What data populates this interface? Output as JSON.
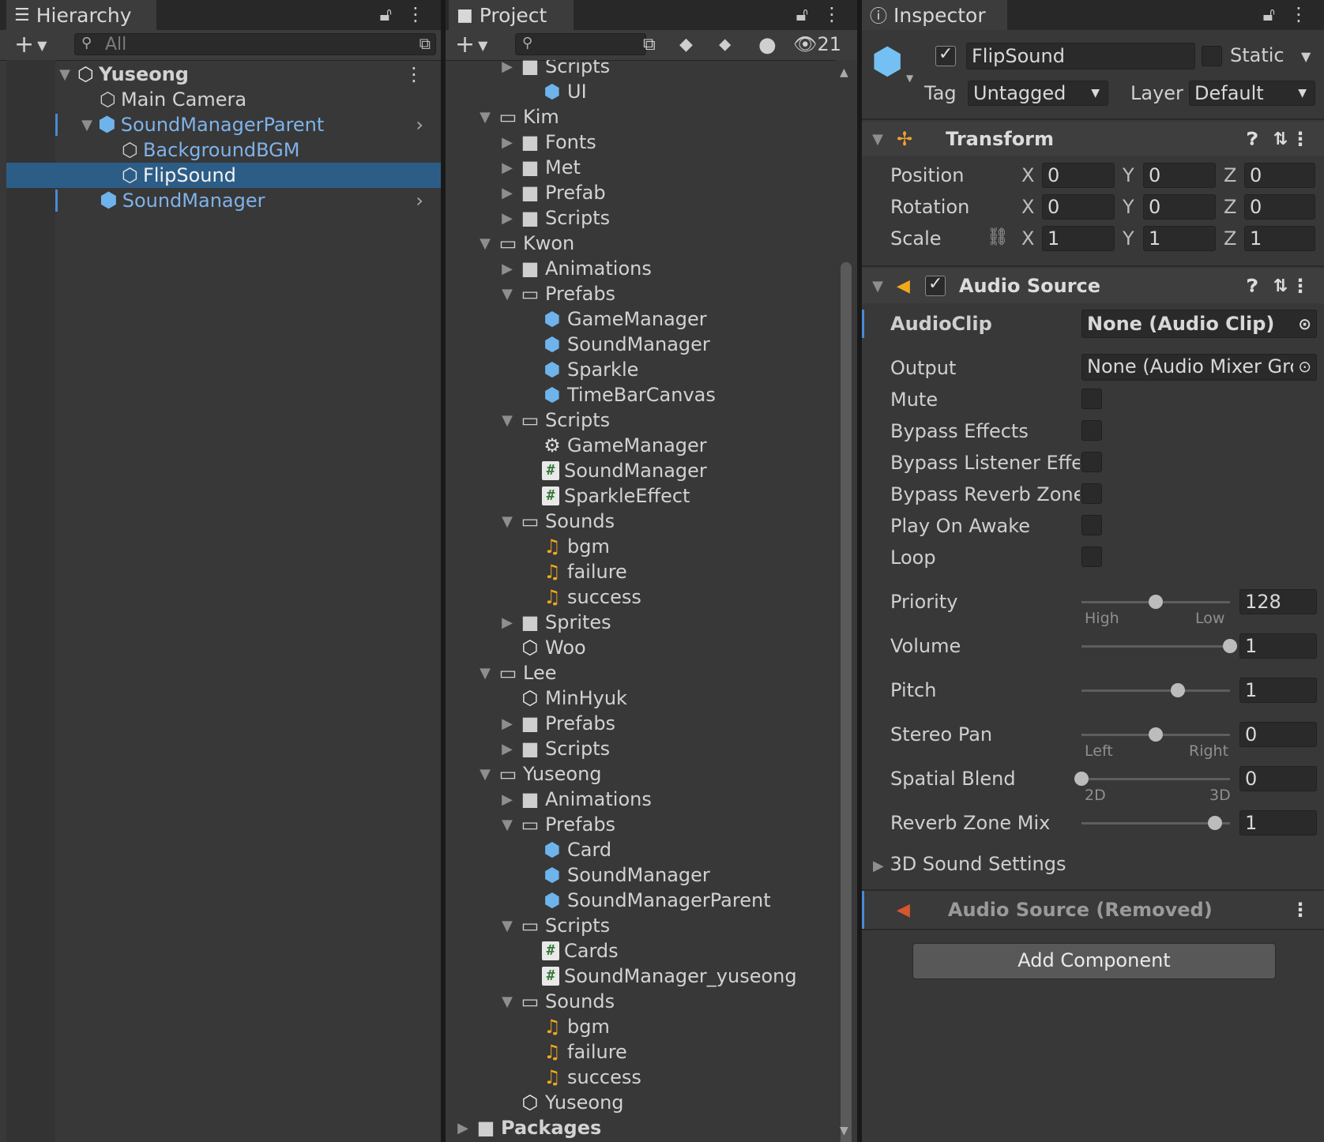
{
  "colors": {
    "selection": "#2c5d87",
    "prefab_blue": "#7fb2ea",
    "audio_orange": "#f2a81d"
  },
  "hierarchy": {
    "tab_label": "Hierarchy",
    "search_placeholder": "All",
    "items": [
      {
        "label": "Yuseong"
      },
      {
        "label": "Main Camera"
      },
      {
        "label": "SoundManagerParent"
      },
      {
        "label": "BackgroundBGM"
      },
      {
        "label": "FlipSound"
      },
      {
        "label": "SoundManager"
      }
    ]
  },
  "project": {
    "tab_label": "Project",
    "hidden_count": "21",
    "items": [
      {
        "label": "Scripts",
        "icon": "folder-icon"
      },
      {
        "label": "UI",
        "icon": "prefab-icon"
      },
      {
        "label": "Kim",
        "icon": "folder-open-icon"
      },
      {
        "label": "Fonts",
        "icon": "folder-icon"
      },
      {
        "label": "Met",
        "icon": "folder-icon"
      },
      {
        "label": "Prefab",
        "icon": "folder-icon"
      },
      {
        "label": "Scripts",
        "icon": "folder-icon"
      },
      {
        "label": "Kwon",
        "icon": "folder-open-icon"
      },
      {
        "label": "Animations",
        "icon": "folder-icon"
      },
      {
        "label": "Prefabs",
        "icon": "folder-open-icon"
      },
      {
        "label": "GameManager",
        "icon": "prefab-icon"
      },
      {
        "label": "SoundManager",
        "icon": "prefab-icon"
      },
      {
        "label": "Sparkle",
        "icon": "prefab-icon"
      },
      {
        "label": "TimeBarCanvas",
        "icon": "prefab-icon"
      },
      {
        "label": "Scripts",
        "icon": "folder-open-icon"
      },
      {
        "label": "GameManager",
        "icon": "gear-icon"
      },
      {
        "label": "SoundManager",
        "icon": "script-icon"
      },
      {
        "label": "SparkleEffect",
        "icon": "script-icon"
      },
      {
        "label": "Sounds",
        "icon": "folder-open-icon"
      },
      {
        "label": "bgm",
        "icon": "audio-clip-icon"
      },
      {
        "label": "failure",
        "icon": "audio-clip-icon"
      },
      {
        "label": "success",
        "icon": "audio-clip-icon"
      },
      {
        "label": "Sprites",
        "icon": "folder-icon"
      },
      {
        "label": "Woo",
        "icon": "unity-scene-icon"
      },
      {
        "label": "Lee",
        "icon": "folder-open-icon"
      },
      {
        "label": "MinHyuk",
        "icon": "unity-scene-icon"
      },
      {
        "label": "Prefabs",
        "icon": "folder-icon"
      },
      {
        "label": "Scripts",
        "icon": "folder-icon"
      },
      {
        "label": "Yuseong",
        "icon": "folder-open-icon"
      },
      {
        "label": "Animations",
        "icon": "folder-icon"
      },
      {
        "label": "Prefabs",
        "icon": "folder-open-icon"
      },
      {
        "label": "Card",
        "icon": "prefab-icon"
      },
      {
        "label": "SoundManager",
        "icon": "prefab-icon"
      },
      {
        "label": "SoundManagerParent",
        "icon": "prefab-icon"
      },
      {
        "label": "Scripts",
        "icon": "folder-open-icon"
      },
      {
        "label": "Cards",
        "icon": "script-icon"
      },
      {
        "label": "SoundManager_yuseong",
        "icon": "script-icon"
      },
      {
        "label": "Sounds",
        "icon": "folder-open-icon"
      },
      {
        "label": "bgm",
        "icon": "audio-clip-icon"
      },
      {
        "label": "failure",
        "icon": "audio-clip-icon"
      },
      {
        "label": "success",
        "icon": "audio-clip-icon"
      },
      {
        "label": "Yuseong",
        "icon": "unity-scene-icon"
      },
      {
        "label": "Packages",
        "icon": "folder-icon"
      }
    ]
  },
  "inspector": {
    "tab_label": "Inspector",
    "object_name": "FlipSound",
    "active": true,
    "static_label": "Static",
    "tag_label": "Tag",
    "tag_value": "Untagged",
    "layer_label": "Layer",
    "layer_value": "Default",
    "transform": {
      "title": "Transform",
      "position_label": "Position",
      "rotation_label": "Rotation",
      "scale_label": "Scale",
      "x": "X",
      "y": "Y",
      "z": "Z",
      "position": [
        "0",
        "0",
        "0"
      ],
      "rotation": [
        "0",
        "0",
        "0"
      ],
      "scale": [
        "1",
        "1",
        "1"
      ]
    },
    "audio_source": {
      "title": "Audio Source",
      "enabled": true,
      "audioclip_label": "AudioClip",
      "audioclip_value": "None (Audio Clip)",
      "output_label": "Output",
      "output_value": "None (Audio Mixer Group)",
      "mute_label": "Mute",
      "bypass_effects_label": "Bypass Effects",
      "bypass_listener_label": "Bypass Listener Effects",
      "bypass_reverb_label": "Bypass Reverb Zones",
      "play_on_awake_label": "Play On Awake",
      "loop_label": "Loop",
      "priority_label": "Priority",
      "priority_value": "128",
      "priority_level": 0.5,
      "priority_low_label": "High",
      "priority_high_label": "Low",
      "volume_label": "Volume",
      "volume_value": "1",
      "volume_level": 1.0,
      "pitch_label": "Pitch",
      "pitch_value": "1",
      "pitch_level": 0.65,
      "stereo_pan_label": "Stereo Pan",
      "stereo_pan_value": "0",
      "stereo_pan_level": 0.5,
      "stereo_left_label": "Left",
      "stereo_right_label": "Right",
      "spatial_blend_label": "Spatial Blend",
      "spatial_blend_value": "0",
      "spatial_blend_level": 0.0,
      "spatial_2d_label": "2D",
      "spatial_3d_label": "3D",
      "reverb_mix_label": "Reverb Zone Mix",
      "reverb_mix_value": "1",
      "reverb_mix_level": 0.9,
      "sound3d_label": "3D Sound Settings"
    },
    "removed_component_label": "Audio Source (Removed)",
    "add_component_label": "Add Component"
  }
}
